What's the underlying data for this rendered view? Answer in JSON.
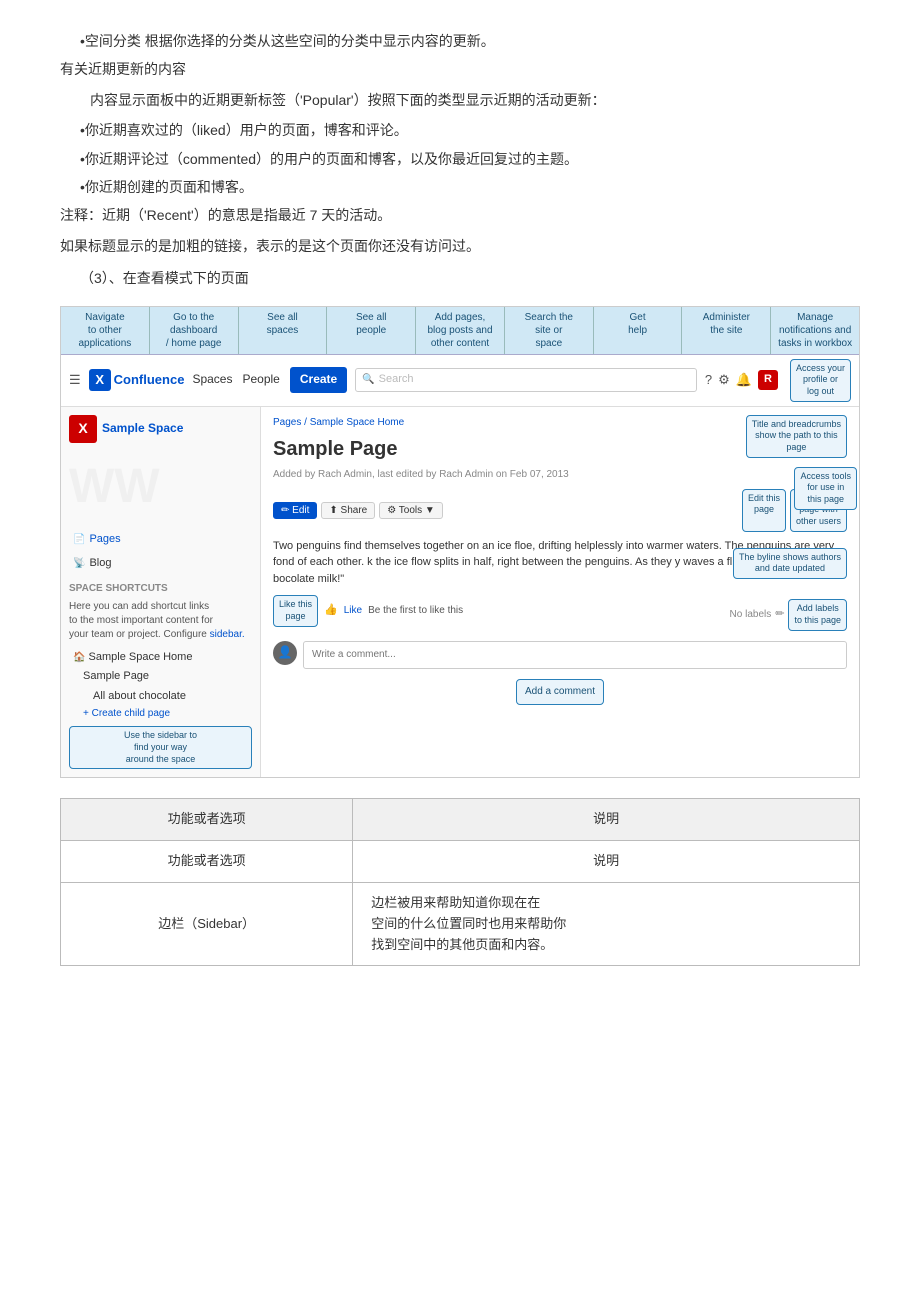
{
  "content": {
    "bullet1": "•空间分类 根据你选择的分类从这些空间的分类中显示内容的更新。",
    "section_heading": "有关近期更新的内容",
    "section_intro": "内容显示面板中的近期更新标签（'Popular'）按照下面的类型显示近期的活动更新：",
    "bullet2": "•你近期喜欢过的（liked）用户的页面，博客和评论。",
    "bullet3": "•你近期评论过（commented）的用户的页面和博客，以及你最近回复过的主题。",
    "bullet4": "•你近期创建的页面和博客。",
    "note1": "注释：近期（'Recent'）的意思是指最近 7 天的活动。",
    "note2": "如果标题显示的是加粗的链接，表示的是这个页面你还没有访问过。",
    "section3_heading": "（3）、在查看模式下的页面"
  },
  "anno_bar": {
    "cells": [
      "Navigate\nto other\napplications",
      "Go to the\ndashboard\n/ home page",
      "See all\nspaces",
      "See all\npeople",
      "Add pages,\nblog posts and\nother content",
      "Search the\nsite or\nspace",
      "Get\nhelp",
      "Administer\nthe site",
      "Manage\nnotifications and\ntasks in workbox"
    ]
  },
  "nav": {
    "logo_text": "Confluence",
    "logo_letter": "X",
    "spaces": "Spaces",
    "people": "People",
    "create": "Create",
    "search_placeholder": "Search",
    "access_profile": "Access your\nprofile or\nlog out",
    "access_tools": "Access tools\nfor use in\nthis page"
  },
  "sidebar": {
    "space_name": "Sample Space",
    "space_letter": "X",
    "pages_label": "Pages",
    "blog_label": "Blog",
    "shortcuts_heading": "SPACE SHORTCUTS",
    "shortcuts_text1": "Here you can add shortcut links",
    "shortcuts_text2": "to the most important content for",
    "shortcuts_text3": "your team or project. Configure",
    "shortcuts_link": "sidebar.",
    "tree_home": "Sample Space Home",
    "tree_page": "Sample Page",
    "tree_child1": "All about chocolate",
    "tree_add": "+ Create child page",
    "sidebar_anno": "Use the sidebar to\nfind your way\naround the space"
  },
  "main": {
    "breadcrumb": "Pages / Sample Space Home",
    "title": "Sample Page",
    "byline": "Added by Rach Admin, last edited by Rach Admin on Feb 07, 2013",
    "edit_btn": "✏ Edit",
    "share_btn": "⬆ Share",
    "tools_btn": "⚙ Tools ▼",
    "edit_page_btn": "Edit this\npage",
    "share_page_btn": "Share this\npage with\nother users",
    "content_text": "Two penguins find themselves together on an ice floe, drifting helplessly into warmer waters. The penguins are very fond of each other. k the ice flow splits in half, right between the penguins. As they   y waves a flipper and calls out bocolate milk!\"",
    "like_icon": "👍",
    "like_text": "Like",
    "like_first": "Be the first to like this",
    "no_labels": "No labels",
    "add_labels": "Add labels\nto this page",
    "comment_placeholder": "Write a comment...",
    "add_comment_btn": "Add a\ncomment",
    "title_anno": "Title and breadcrumbs\nshow the path to this\npage",
    "byline_anno": "The byline shows authors\nand date updated",
    "like_anno": "Like this\npage"
  },
  "table": {
    "col1_header": "功能或者选项",
    "col2_header": "说明",
    "rows": [
      {
        "col1": "功能或者选项",
        "col2": "说明"
      },
      {
        "col1": "边栏（Sidebar）",
        "col2": "边栏被用来帮助知道你现在在\n空间的什么位置同时也用来帮助你\n找到空间中的其他页面和内容。"
      }
    ]
  }
}
